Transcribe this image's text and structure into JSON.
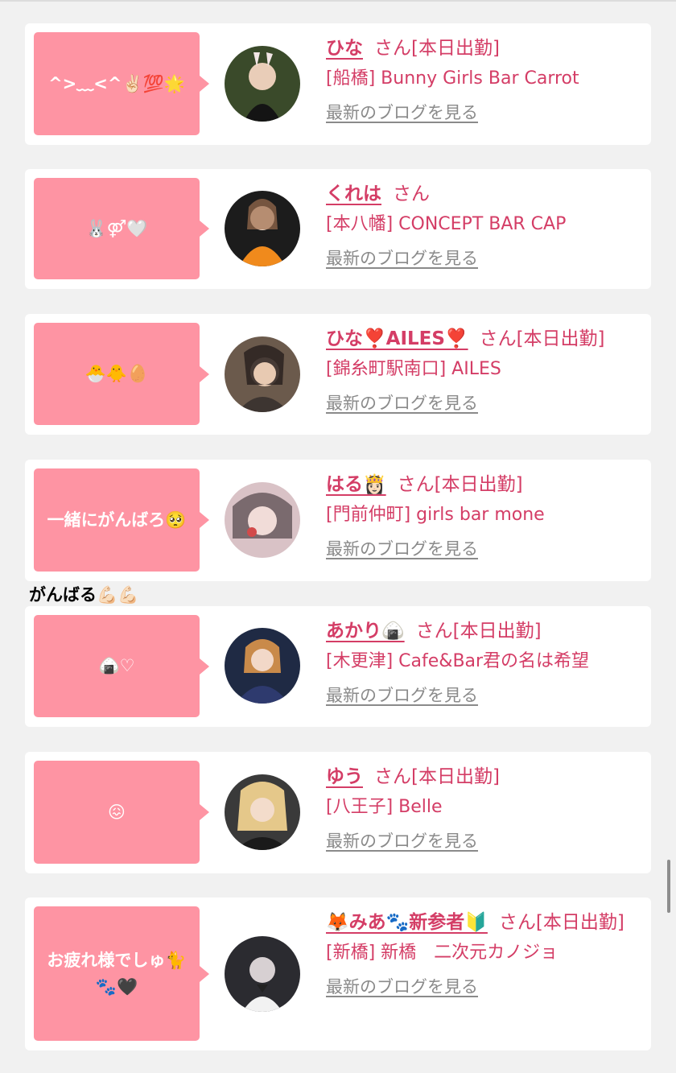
{
  "cards": [
    {
      "comment": "^>﹏<^✌🏻💯🌟",
      "name": "ひな",
      "san": "さん[本日出勤]",
      "shop": "[船橋] Bunny Girls Bar Carrot",
      "blog": "最新のブログを見る",
      "avatar_color": "#3a4a2a"
    },
    {
      "comment": "🐰⚤🤍",
      "name": "くれは",
      "san": "さん",
      "shop": "[本八幡] CONCEPT BAR CAP",
      "blog": "最新のブログを見る",
      "avatar_color": "#f08a1c"
    },
    {
      "comment": "🐣🐥🥚",
      "name": "ひな❣️AILES❣️",
      "san": "さん[本日出勤]",
      "shop": "[錦糸町駅南口] AILES",
      "blog": "最新のブログを見る",
      "avatar_color": "#6b5a4c"
    },
    {
      "comment": "一緒にがんばろ🥺",
      "name": "はる👸🏻",
      "san": "さん[本日出勤]",
      "shop": "[門前仲町] girls bar mone",
      "blog": "最新のブログを見る",
      "avatar_color": "#c9a6ad"
    },
    {
      "comment": "🍙♡",
      "name": "あかり🍙",
      "san": "さん[本日出勤]",
      "shop": "[木更津] Cafe&Bar君の名は希望",
      "blog": "最新のブログを見る",
      "avatar_color": "#2e3a6e"
    },
    {
      "comment": "😖",
      "name": "ゆう",
      "san": "さん[本日出勤]",
      "shop": "[八王子] Belle",
      "blog": "最新のブログを見る",
      "avatar_color": "#e5c88a"
    },
    {
      "comment": "お疲れ様でしゅ🐈\n🐾🖤",
      "name": "🦊みあ🐾新参者🔰",
      "san": "さん[本日出勤]",
      "shop": "[新橋] 新橋　二次元カノジョ",
      "blog": "最新のブログを見る",
      "avatar_color": "#2b2b30"
    }
  ],
  "between_text": "がんばる💪🏻💪🏻",
  "colors": {
    "accent": "#d43d66",
    "bubble": "#fe94a3",
    "background": "#f1f1f1"
  }
}
